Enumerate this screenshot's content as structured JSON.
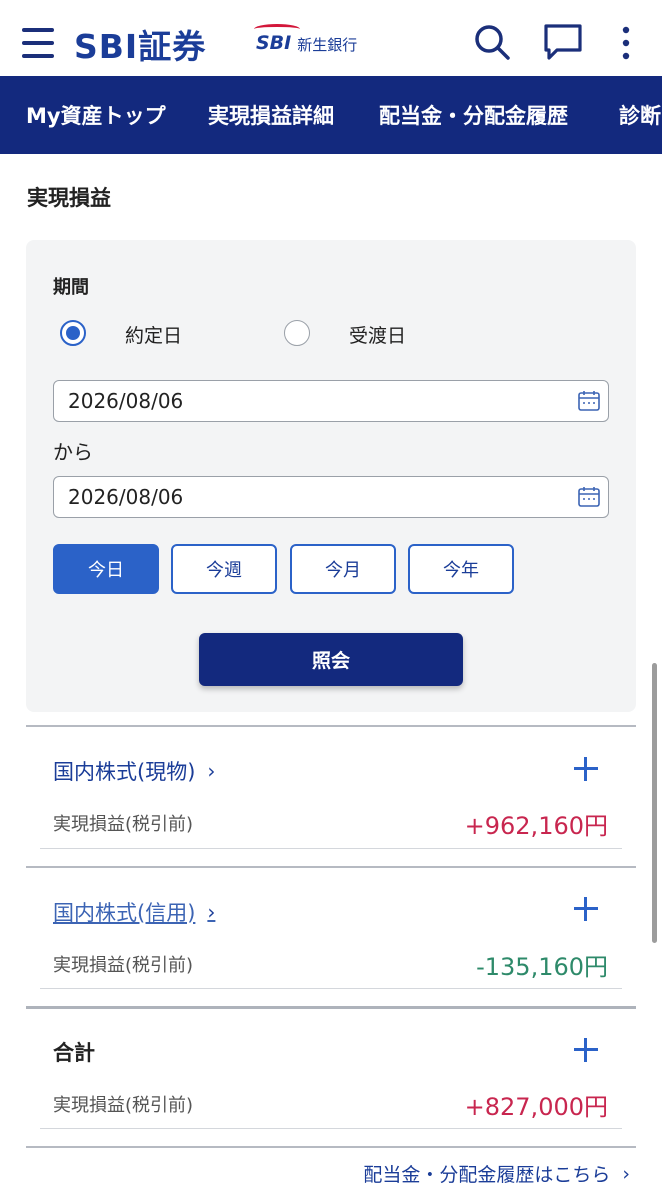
{
  "header": {
    "brand": "SBI証券",
    "bank_logo_mark": "SBI",
    "bank_logo_text": "新生銀行",
    "icons": [
      "menu-icon",
      "search-icon",
      "chat-icon",
      "more-icon"
    ]
  },
  "nav": {
    "items": [
      "My資産トップ",
      "実現損益詳細",
      "配当金・分配金履歴",
      "診断"
    ]
  },
  "section_title": "実現損益",
  "filter": {
    "period_label": "期間",
    "radio_options": [
      {
        "label": "約定日",
        "checked": true
      },
      {
        "label": "受渡日",
        "checked": false
      }
    ],
    "start_date": "2026/08/06",
    "from_label": "から",
    "end_date": "2026/08/06",
    "quick_buttons": [
      {
        "label": "今日",
        "active": true
      },
      {
        "label": "今週",
        "active": false
      },
      {
        "label": "今月",
        "active": false
      },
      {
        "label": "今年",
        "active": false
      }
    ],
    "submit_label": "照会"
  },
  "results": [
    {
      "title": "国内株式(現物)",
      "label": "実現損益(税引前)",
      "value": "+962,160円",
      "sign": "positive"
    },
    {
      "title": "国内株式(信用)",
      "label": "実現損益(税引前)",
      "value": "-135,160円",
      "sign": "negative"
    },
    {
      "title": "合計",
      "label": "実現損益(税引前)",
      "value": "+827,000円",
      "sign": "positive"
    }
  ],
  "footer_link": "配当金・分配金履歴はこちら",
  "colors": {
    "navy": "#13297e",
    "accent_blue": "#2b62c8",
    "positive": "#c8264f",
    "negative": "#2e8a6a"
  }
}
